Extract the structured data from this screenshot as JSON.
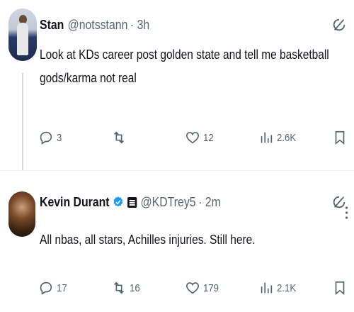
{
  "tweets": [
    {
      "display_name": "Stan",
      "handle": "@notsstann",
      "time": "· 3h",
      "text": "Look at KDs career post golden state and tell me basketball gods/karma not real",
      "stats": {
        "replies": "3",
        "retweets": "",
        "likes": "12",
        "views": "2.6K"
      }
    },
    {
      "display_name": "Kevin Durant",
      "handle": "@KDTrey5",
      "time": "· 2m",
      "text": "All nbas, all stars, Achilles injuries. Still here.",
      "stats": {
        "replies": "17",
        "retweets": "16",
        "likes": "179",
        "views": "2.1K"
      }
    }
  ],
  "colors": {
    "verified": "#1d9bf0",
    "secondary_text": "#536471",
    "text": "#0f1419"
  }
}
